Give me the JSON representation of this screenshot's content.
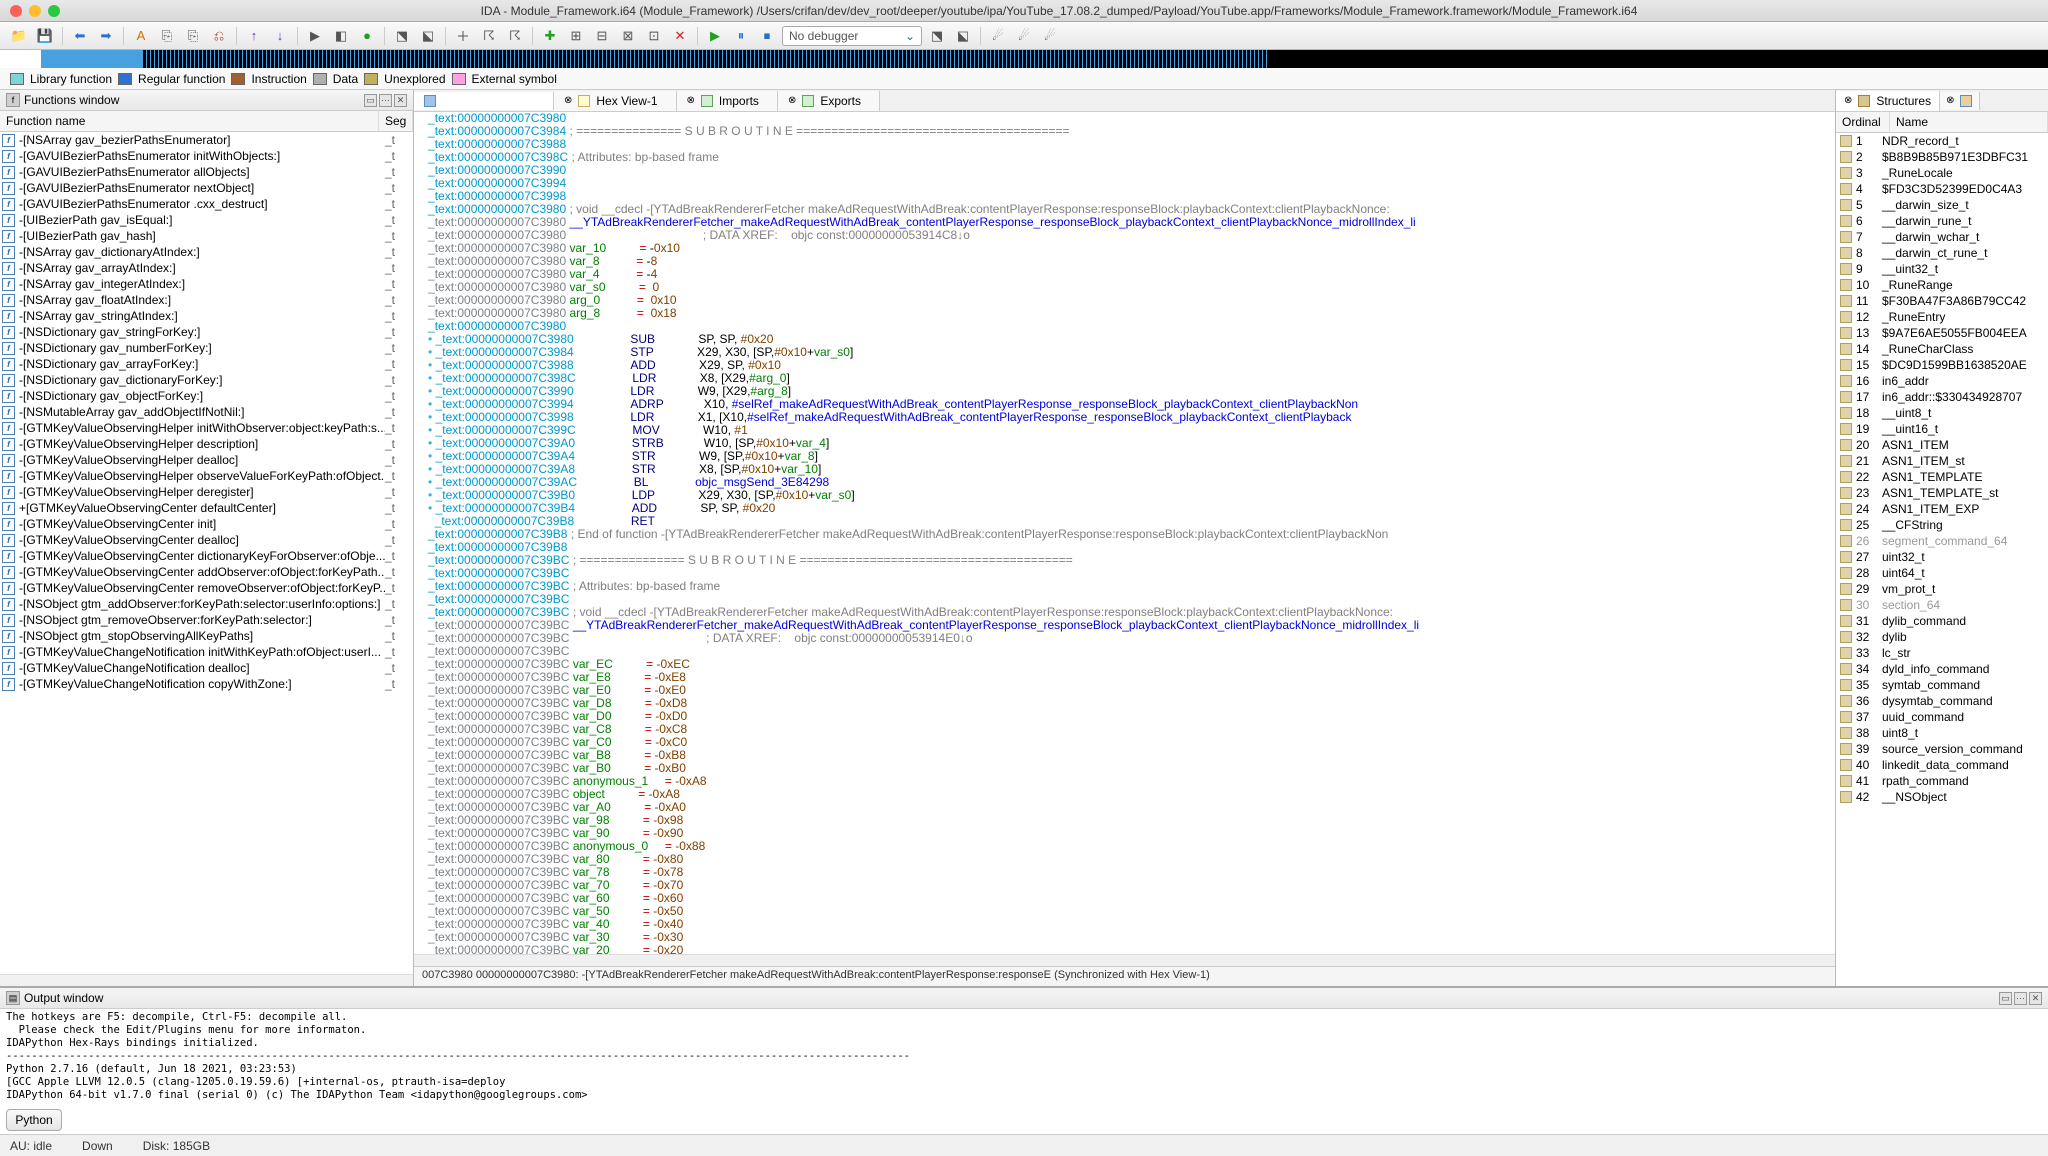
{
  "window_title": "IDA - Module_Framework.i64 (Module_Framework) /Users/crifan/dev/dev_root/deeper/youtube/ipa/YouTube_17.08.2_dumped/Payload/YouTube.app/Frameworks/Module_Framework.framework/Module_Framework.i64",
  "debugger_sel": "No debugger",
  "legend": {
    "lib": "Library function",
    "reg": "Regular function",
    "ins": "Instruction",
    "data": "Data",
    "unexp": "Unexplored",
    "ext": "External symbol"
  },
  "functions_window": {
    "title": "Functions window",
    "col_name": "Function name",
    "col_seg": "Seg",
    "items": [
      "-[NSArray gav_bezierPathsEnumerator]",
      "-[GAVUIBezierPathsEnumerator initWithObjects:]",
      "-[GAVUIBezierPathsEnumerator allObjects]",
      "-[GAVUIBezierPathsEnumerator nextObject]",
      "-[GAVUIBezierPathsEnumerator .cxx_destruct]",
      "-[UIBezierPath gav_isEqual:]",
      "-[UIBezierPath gav_hash]",
      "-[NSArray gav_dictionaryAtIndex:]",
      "-[NSArray gav_arrayAtIndex:]",
      "-[NSArray gav_integerAtIndex:]",
      "-[NSArray gav_floatAtIndex:]",
      "-[NSArray gav_stringAtIndex:]",
      "-[NSDictionary gav_stringForKey:]",
      "-[NSDictionary gav_numberForKey:]",
      "-[NSDictionary gav_arrayForKey:]",
      "-[NSDictionary gav_dictionaryForKey:]",
      "-[NSDictionary gav_objectForKey:]",
      "-[NSMutableArray gav_addObjectIfNotNil:]",
      "-[GTMKeyValueObservingHelper initWithObserver:object:keyPath:s...",
      "-[GTMKeyValueObservingHelper description]",
      "-[GTMKeyValueObservingHelper dealloc]",
      "-[GTMKeyValueObservingHelper observeValueForKeyPath:ofObject...",
      "-[GTMKeyValueObservingHelper deregister]",
      "+[GTMKeyValueObservingCenter defaultCenter]",
      "-[GTMKeyValueObservingCenter init]",
      "-[GTMKeyValueObservingCenter dealloc]",
      "-[GTMKeyValueObservingCenter dictionaryKeyForObserver:ofObje...",
      "-[GTMKeyValueObservingCenter addObserver:ofObject:forKeyPath...",
      "-[GTMKeyValueObservingCenter removeObserver:ofObject:forKeyP...",
      "-[NSObject gtm_addObserver:forKeyPath:selector:userInfo:options:]",
      "-[NSObject gtm_removeObserver:forKeyPath:selector:]",
      "-[NSObject gtm_stopObservingAllKeyPaths]",
      "-[GTMKeyValueChangeNotification initWithKeyPath:ofObject:userI...",
      "-[GTMKeyValueChangeNotification dealloc]",
      "-[GTMKeyValueChangeNotification copyWithZone:]"
    ],
    "seg": "_t"
  },
  "tabs": {
    "ida_view": "",
    "hex_view": "Hex View-1",
    "imports": "Imports",
    "exports": "Exports",
    "structures": "Structures"
  },
  "disasm_addr_label": "_text:00000000007C39",
  "status_line": "007C3980  00000000007C3980: -[YTAdBreakRendererFetcher makeAdRequestWithAdBreak:contentPlayerResponse:responseE  (Synchronized with Hex View-1)",
  "structures": {
    "ord_hdr": "Ordinal",
    "name_hdr": "Name",
    "rows": [
      {
        "o": "1",
        "n": "NDR_record_t"
      },
      {
        "o": "2",
        "n": "$B8B9B85B971E3DBFC31"
      },
      {
        "o": "3",
        "n": "_RuneLocale"
      },
      {
        "o": "4",
        "n": "$FD3C3D52399ED0C4A3"
      },
      {
        "o": "5",
        "n": "__darwin_size_t"
      },
      {
        "o": "6",
        "n": "__darwin_rune_t"
      },
      {
        "o": "7",
        "n": "__darwin_wchar_t"
      },
      {
        "o": "8",
        "n": "__darwin_ct_rune_t"
      },
      {
        "o": "9",
        "n": "__uint32_t"
      },
      {
        "o": "10",
        "n": "_RuneRange"
      },
      {
        "o": "11",
        "n": "$F30BA47F3A86B79CC42"
      },
      {
        "o": "12",
        "n": "_RuneEntry"
      },
      {
        "o": "13",
        "n": "$9A7E6AE5055FB004EEA"
      },
      {
        "o": "14",
        "n": "_RuneCharClass"
      },
      {
        "o": "15",
        "n": "$DC9D1599BB1638520AE"
      },
      {
        "o": "16",
        "n": "in6_addr"
      },
      {
        "o": "17",
        "n": "in6_addr::$330434928707"
      },
      {
        "o": "18",
        "n": "__uint8_t"
      },
      {
        "o": "19",
        "n": "__uint16_t"
      },
      {
        "o": "20",
        "n": "ASN1_ITEM"
      },
      {
        "o": "21",
        "n": "ASN1_ITEM_st"
      },
      {
        "o": "22",
        "n": "ASN1_TEMPLATE"
      },
      {
        "o": "23",
        "n": "ASN1_TEMPLATE_st"
      },
      {
        "o": "24",
        "n": "ASN1_ITEM_EXP"
      },
      {
        "o": "25",
        "n": "__CFString"
      },
      {
        "o": "26",
        "n": "segment_command_64",
        "g": true
      },
      {
        "o": "27",
        "n": "uint32_t"
      },
      {
        "o": "28",
        "n": "uint64_t"
      },
      {
        "o": "29",
        "n": "vm_prot_t"
      },
      {
        "o": "30",
        "n": "section_64",
        "g": true
      },
      {
        "o": "31",
        "n": "dylib_command"
      },
      {
        "o": "32",
        "n": "dylib"
      },
      {
        "o": "33",
        "n": "lc_str"
      },
      {
        "o": "34",
        "n": "dyld_info_command"
      },
      {
        "o": "35",
        "n": "symtab_command"
      },
      {
        "o": "36",
        "n": "dysymtab_command"
      },
      {
        "o": "37",
        "n": "uuid_command"
      },
      {
        "o": "38",
        "n": "uint8_t"
      },
      {
        "o": "39",
        "n": "source_version_command"
      },
      {
        "o": "40",
        "n": "linkedit_data_command"
      },
      {
        "o": "41",
        "n": "rpath_command"
      },
      {
        "o": "42",
        "n": "__NSObject"
      }
    ]
  },
  "output_window": {
    "title": "Output window",
    "body": "The hotkeys are F5: decompile, Ctrl-F5: decompile all.\n  Please check the Edit/Plugins menu for more informaton.\nIDAPython Hex-Rays bindings initialized.\n-----------------------------------------------------------------------------------------------------------------------------------------------\nPython 2.7.16 (default, Jun 18 2021, 03:23:53)\n[GCC Apple LLVM 12.0.5 (clang-1205.0.19.59.6) [+internal-os, ptrauth-isa=deploy\nIDAPython 64-bit v1.7.0 final (serial 0) (c) The IDAPython Team <idapython@googlegroups.com>\n-----------------------------------------------------------------------------------------------------------------------------------------------"
  },
  "python_btn": "Python",
  "footer": {
    "au": "AU:  idle",
    "down": "Down",
    "disk": "Disk: 185GB"
  }
}
